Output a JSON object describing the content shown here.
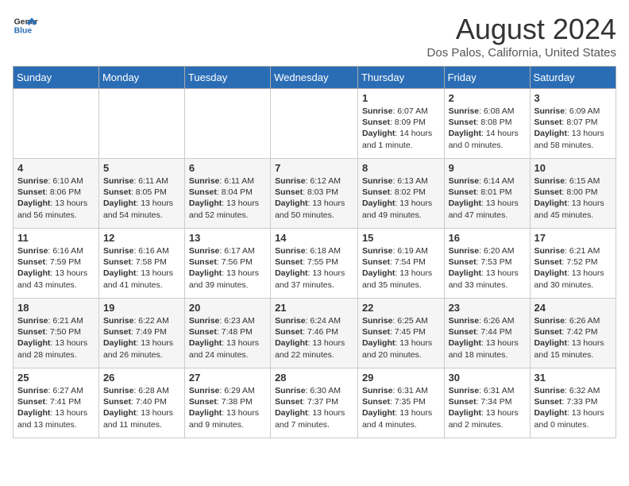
{
  "header": {
    "logo_line1": "General",
    "logo_line2": "Blue",
    "month_title": "August 2024",
    "location": "Dos Palos, California, United States"
  },
  "weekdays": [
    "Sunday",
    "Monday",
    "Tuesday",
    "Wednesday",
    "Thursday",
    "Friday",
    "Saturday"
  ],
  "weeks": [
    [
      {
        "day": "",
        "text": ""
      },
      {
        "day": "",
        "text": ""
      },
      {
        "day": "",
        "text": ""
      },
      {
        "day": "",
        "text": ""
      },
      {
        "day": "1",
        "text": "Sunrise: 6:07 AM\nSunset: 8:09 PM\nDaylight: 14 hours and 1 minute."
      },
      {
        "day": "2",
        "text": "Sunrise: 6:08 AM\nSunset: 8:08 PM\nDaylight: 14 hours and 0 minutes."
      },
      {
        "day": "3",
        "text": "Sunrise: 6:09 AM\nSunset: 8:07 PM\nDaylight: 13 hours and 58 minutes."
      }
    ],
    [
      {
        "day": "4",
        "text": "Sunrise: 6:10 AM\nSunset: 8:06 PM\nDaylight: 13 hours and 56 minutes."
      },
      {
        "day": "5",
        "text": "Sunrise: 6:11 AM\nSunset: 8:05 PM\nDaylight: 13 hours and 54 minutes."
      },
      {
        "day": "6",
        "text": "Sunrise: 6:11 AM\nSunset: 8:04 PM\nDaylight: 13 hours and 52 minutes."
      },
      {
        "day": "7",
        "text": "Sunrise: 6:12 AM\nSunset: 8:03 PM\nDaylight: 13 hours and 50 minutes."
      },
      {
        "day": "8",
        "text": "Sunrise: 6:13 AM\nSunset: 8:02 PM\nDaylight: 13 hours and 49 minutes."
      },
      {
        "day": "9",
        "text": "Sunrise: 6:14 AM\nSunset: 8:01 PM\nDaylight: 13 hours and 47 minutes."
      },
      {
        "day": "10",
        "text": "Sunrise: 6:15 AM\nSunset: 8:00 PM\nDaylight: 13 hours and 45 minutes."
      }
    ],
    [
      {
        "day": "11",
        "text": "Sunrise: 6:16 AM\nSunset: 7:59 PM\nDaylight: 13 hours and 43 minutes."
      },
      {
        "day": "12",
        "text": "Sunrise: 6:16 AM\nSunset: 7:58 PM\nDaylight: 13 hours and 41 minutes."
      },
      {
        "day": "13",
        "text": "Sunrise: 6:17 AM\nSunset: 7:56 PM\nDaylight: 13 hours and 39 minutes."
      },
      {
        "day": "14",
        "text": "Sunrise: 6:18 AM\nSunset: 7:55 PM\nDaylight: 13 hours and 37 minutes."
      },
      {
        "day": "15",
        "text": "Sunrise: 6:19 AM\nSunset: 7:54 PM\nDaylight: 13 hours and 35 minutes."
      },
      {
        "day": "16",
        "text": "Sunrise: 6:20 AM\nSunset: 7:53 PM\nDaylight: 13 hours and 33 minutes."
      },
      {
        "day": "17",
        "text": "Sunrise: 6:21 AM\nSunset: 7:52 PM\nDaylight: 13 hours and 30 minutes."
      }
    ],
    [
      {
        "day": "18",
        "text": "Sunrise: 6:21 AM\nSunset: 7:50 PM\nDaylight: 13 hours and 28 minutes."
      },
      {
        "day": "19",
        "text": "Sunrise: 6:22 AM\nSunset: 7:49 PM\nDaylight: 13 hours and 26 minutes."
      },
      {
        "day": "20",
        "text": "Sunrise: 6:23 AM\nSunset: 7:48 PM\nDaylight: 13 hours and 24 minutes."
      },
      {
        "day": "21",
        "text": "Sunrise: 6:24 AM\nSunset: 7:46 PM\nDaylight: 13 hours and 22 minutes."
      },
      {
        "day": "22",
        "text": "Sunrise: 6:25 AM\nSunset: 7:45 PM\nDaylight: 13 hours and 20 minutes."
      },
      {
        "day": "23",
        "text": "Sunrise: 6:26 AM\nSunset: 7:44 PM\nDaylight: 13 hours and 18 minutes."
      },
      {
        "day": "24",
        "text": "Sunrise: 6:26 AM\nSunset: 7:42 PM\nDaylight: 13 hours and 15 minutes."
      }
    ],
    [
      {
        "day": "25",
        "text": "Sunrise: 6:27 AM\nSunset: 7:41 PM\nDaylight: 13 hours and 13 minutes."
      },
      {
        "day": "26",
        "text": "Sunrise: 6:28 AM\nSunset: 7:40 PM\nDaylight: 13 hours and 11 minutes."
      },
      {
        "day": "27",
        "text": "Sunrise: 6:29 AM\nSunset: 7:38 PM\nDaylight: 13 hours and 9 minutes."
      },
      {
        "day": "28",
        "text": "Sunrise: 6:30 AM\nSunset: 7:37 PM\nDaylight: 13 hours and 7 minutes."
      },
      {
        "day": "29",
        "text": "Sunrise: 6:31 AM\nSunset: 7:35 PM\nDaylight: 13 hours and 4 minutes."
      },
      {
        "day": "30",
        "text": "Sunrise: 6:31 AM\nSunset: 7:34 PM\nDaylight: 13 hours and 2 minutes."
      },
      {
        "day": "31",
        "text": "Sunrise: 6:32 AM\nSunset: 7:33 PM\nDaylight: 13 hours and 0 minutes."
      }
    ]
  ]
}
